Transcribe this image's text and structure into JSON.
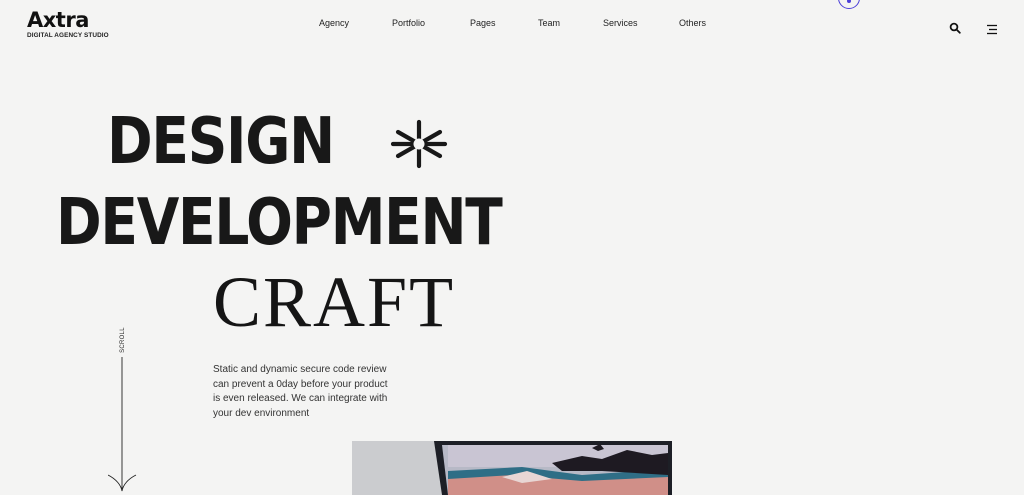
{
  "brand": {
    "name": "Axtra",
    "tagline": "DIGITAL AGENCY STUDIO"
  },
  "nav": {
    "items": [
      {
        "label": "Agency"
      },
      {
        "label": "Portfolio"
      },
      {
        "label": "Pages"
      },
      {
        "label": "Team"
      },
      {
        "label": "Services"
      },
      {
        "label": "Others"
      }
    ]
  },
  "header": {
    "search_icon": "search-icon",
    "menu_icon": "hamburger-menu-icon",
    "accent_color": "#4b3fd8"
  },
  "hero": {
    "line1": "DESIGN",
    "line2": "DEVELOPMENT",
    "line3": "CRAFT",
    "decor_icon": "asterisk-icon",
    "scroll_label": "SCROLL",
    "description": "Static and dynamic secure code review can prevent a 0day before your product is even released. We can integrate with your dev environment"
  },
  "colors": {
    "background": "#f4f4f3",
    "text": "#181818"
  }
}
